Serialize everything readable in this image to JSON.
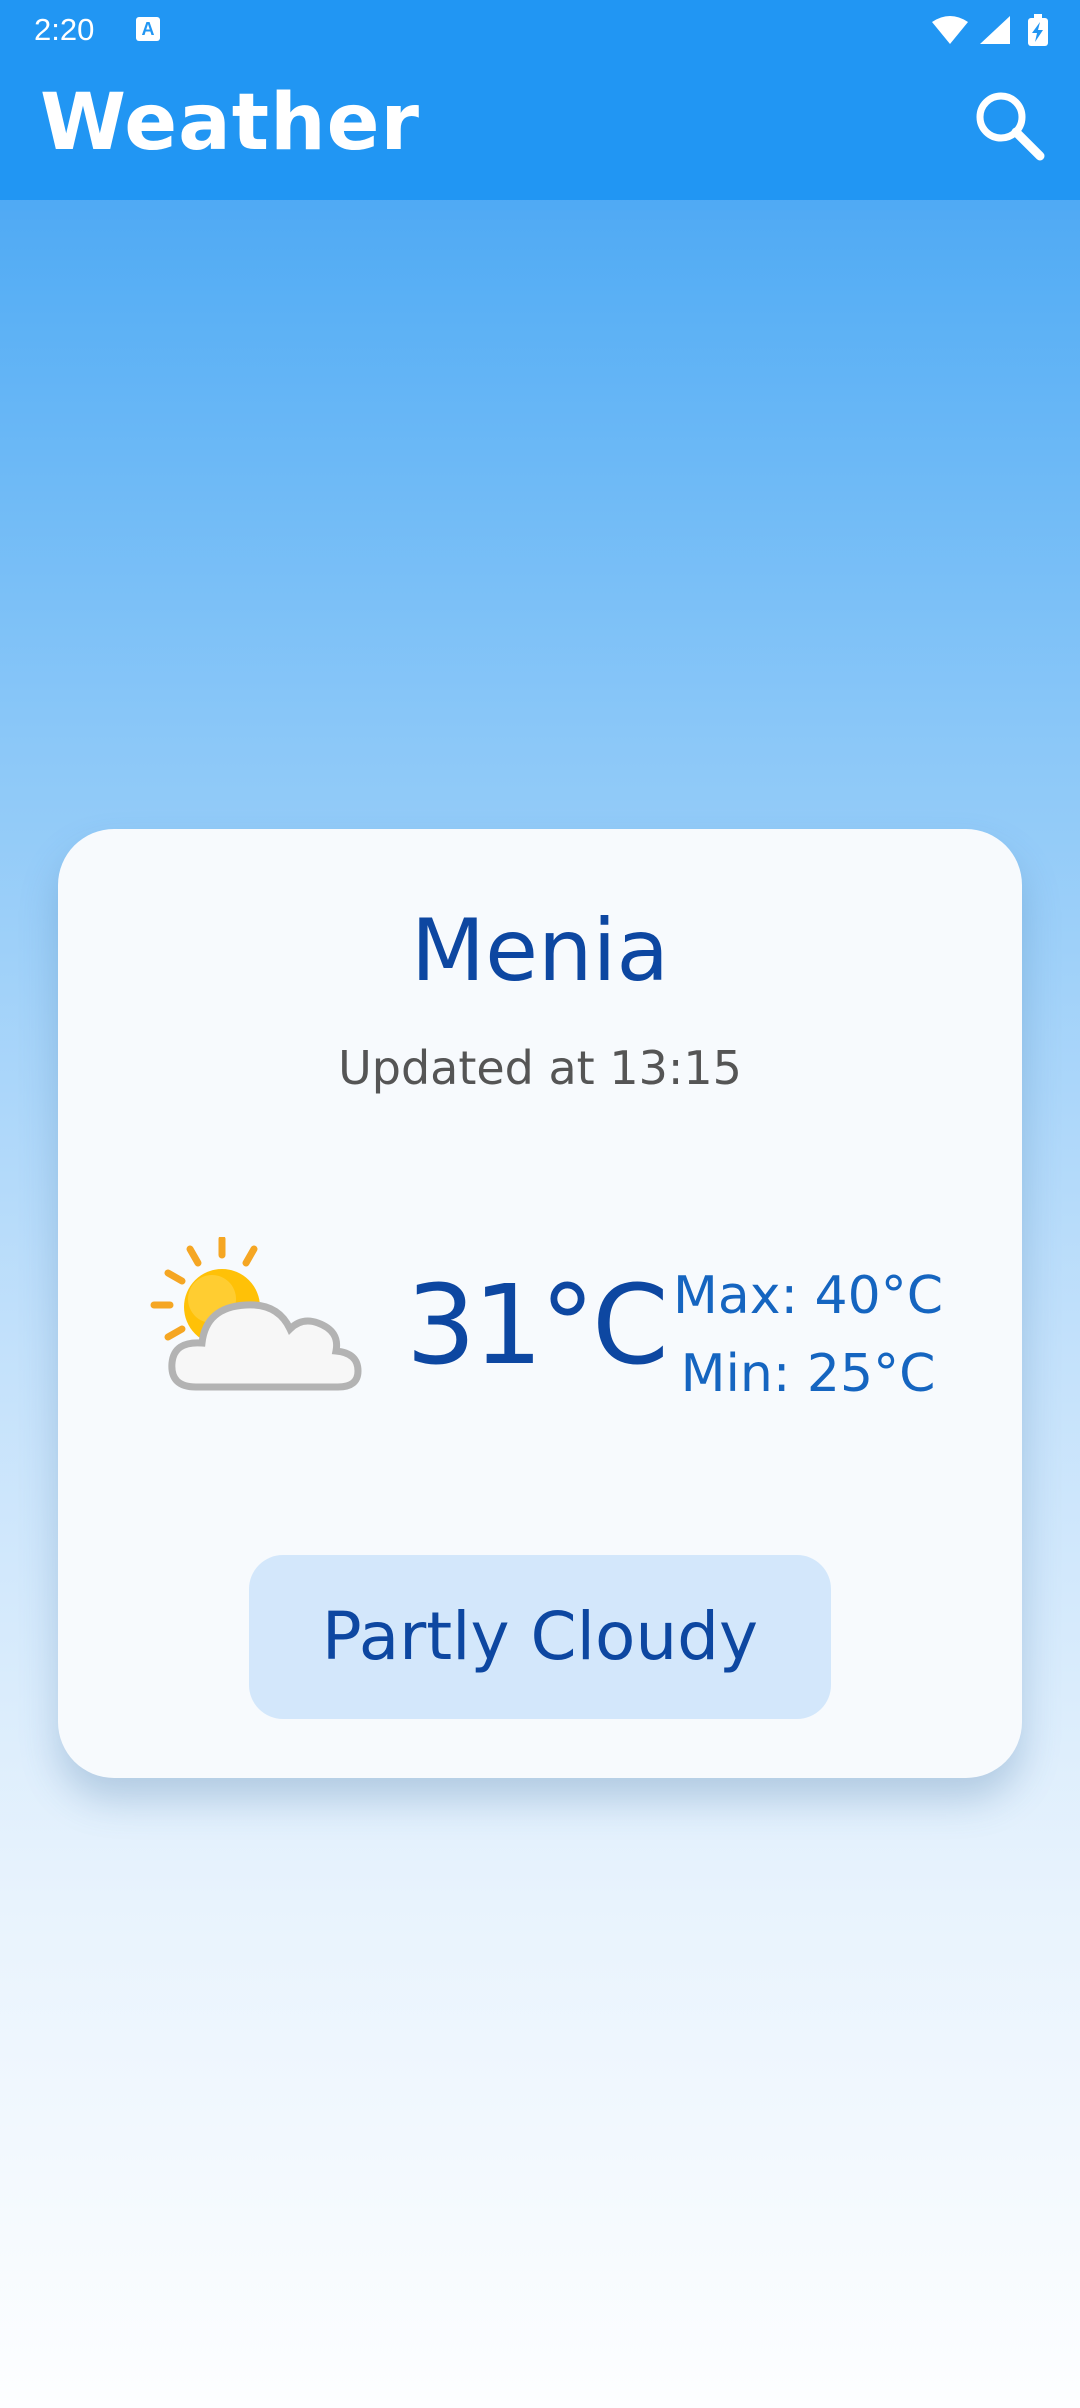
{
  "status_bar": {
    "time": "2:20",
    "notification_icon_letter": "A",
    "icons": [
      "wifi-icon",
      "signal-icon",
      "battery-charging-icon"
    ]
  },
  "app_bar": {
    "title": "Weather",
    "search_icon": "search-icon"
  },
  "weather_card": {
    "city": "Menia",
    "updated": "Updated at 13:15",
    "icon": "partly-cloudy-icon",
    "temperature": "31°C",
    "max": "Max: 40°C",
    "min": "Min: 25°C",
    "condition": "Partly Cloudy"
  },
  "colors": {
    "app_bar": "#2196f3",
    "primary_text": "#0d47a1",
    "secondary_text": "#1565c0",
    "condition_chip": "#d3e7fb",
    "card": "#f7fafd"
  }
}
